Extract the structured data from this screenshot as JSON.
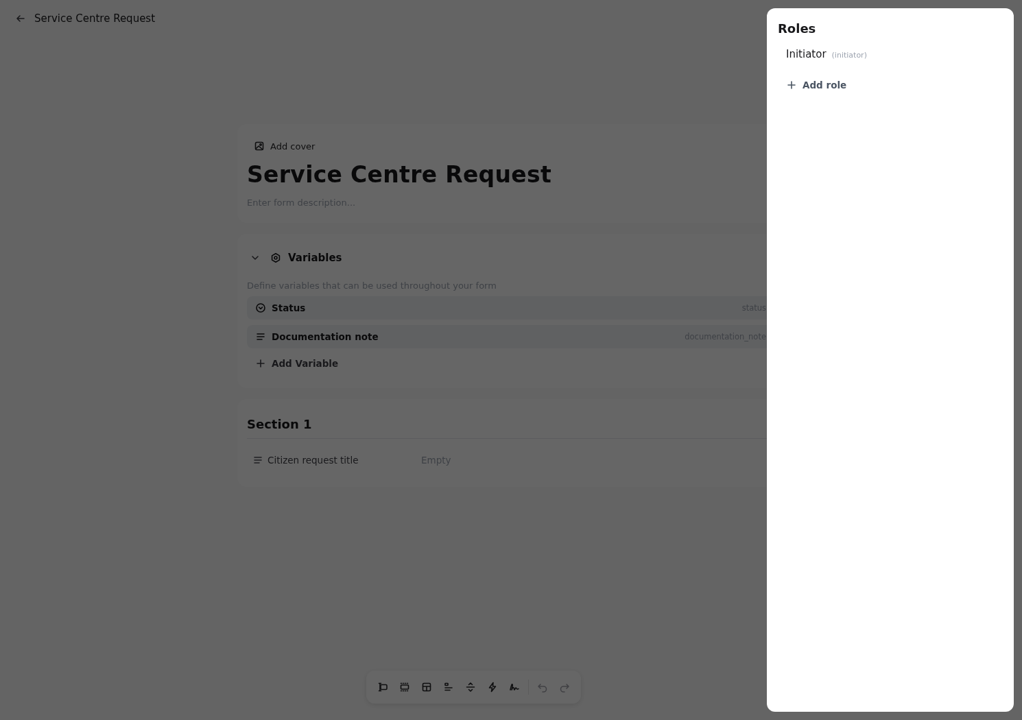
{
  "header": {
    "title": "Service Centre Request"
  },
  "form": {
    "cover_button": "Add cover",
    "title": "Service Centre Request",
    "description": {
      "placeholder": "Enter form description..."
    }
  },
  "variables": {
    "title": "Variables",
    "expanded": true,
    "description": "Define variables that can be used throughout your form",
    "items": [
      {
        "kind": "select",
        "name": "Status",
        "key": "status"
      },
      {
        "kind": "text",
        "name": "Documentation note",
        "key": "documentation_note"
      }
    ],
    "add_button": "Add Variable"
  },
  "sections": [
    {
      "title": "Section 1",
      "fields": [
        {
          "kind": "text",
          "label": "Citizen request title",
          "placeholder": "Empty"
        }
      ]
    }
  ],
  "toolbar": [
    {
      "kind": "input",
      "disabled": false
    },
    {
      "kind": "section",
      "disabled": false
    },
    {
      "kind": "table",
      "disabled": false
    },
    {
      "kind": "align",
      "disabled": false
    },
    {
      "kind": "spacing",
      "disabled": false
    },
    {
      "kind": "action",
      "disabled": false
    },
    {
      "kind": "signature",
      "disabled": false
    },
    {
      "kind": "undo",
      "disabled": true
    },
    {
      "kind": "redo",
      "disabled": true
    }
  ],
  "roles_panel": {
    "title": "Roles",
    "roles": [
      {
        "name": "Initiator",
        "key": "(initiator)"
      }
    ],
    "add_button": "Add role"
  }
}
